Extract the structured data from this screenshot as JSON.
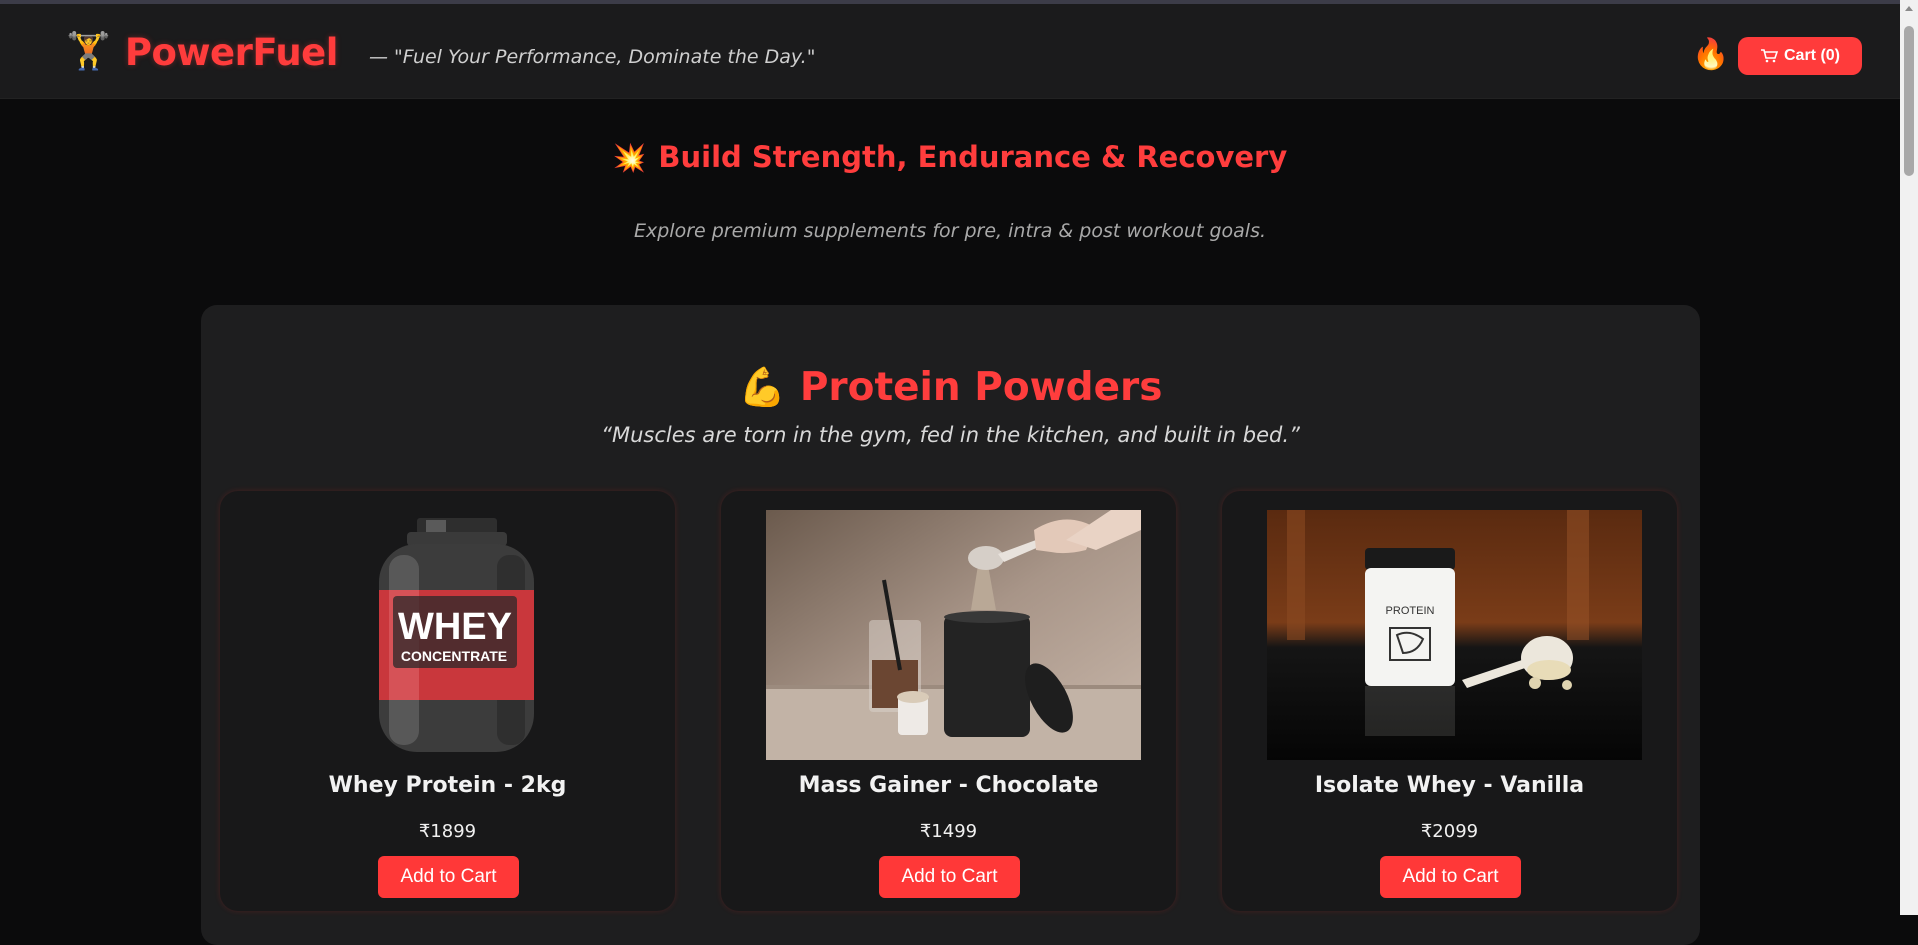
{
  "header": {
    "logo_icon": "weightlifter-icon",
    "logo_emoji": "🏋️",
    "brand": "PowerFuel",
    "tagline": "— \"Fuel Your Performance, Dominate the Day.\"",
    "fire_emoji": "🔥",
    "cart_label": "Cart (0)"
  },
  "hero": {
    "emoji": "💥",
    "title": "Build Strength, Endurance & Recovery",
    "subtitle": "Explore premium supplements for pre, intra & post workout goals."
  },
  "section": {
    "emoji": "💪",
    "title": "Protein Powders",
    "quote": "“Muscles are torn in the gym, fed in the kitchen, and built in bed.”",
    "products": [
      {
        "name": "Whey Protein - 2kg",
        "price": "₹1899",
        "button": "Add to Cart",
        "jar_label_big": "WHEY",
        "jar_label_small": "CONCENTRATE"
      },
      {
        "name": "Mass Gainer - Chocolate",
        "price": "₹1499",
        "button": "Add to Cart"
      },
      {
        "name": "Isolate Whey - Vanilla",
        "price": "₹2099",
        "button": "Add to Cart",
        "jar_label": "PROTEIN"
      }
    ]
  },
  "colors": {
    "accent": "#ff3c3c",
    "background": "#0b0b0c",
    "header_bg": "#1b1b1c",
    "card_bg": "#181819"
  }
}
